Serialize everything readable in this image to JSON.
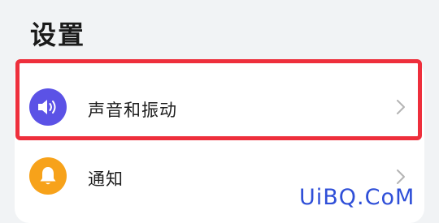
{
  "page": {
    "title": "设置"
  },
  "settings": {
    "items": [
      {
        "label": "声音和振动",
        "icon": "speaker-icon",
        "selected": true
      },
      {
        "label": "通知",
        "icon": "bell-icon",
        "selected": false
      }
    ]
  },
  "watermark": "UiBQ.CoM",
  "colors": {
    "background": "#f1f3f5",
    "card": "#ffffff",
    "highlight_border": "#ee2f3c",
    "sound_icon_bg": "#5b52e6",
    "notify_icon_bg": "#f7a21a",
    "watermark": "#2f4fd8"
  }
}
